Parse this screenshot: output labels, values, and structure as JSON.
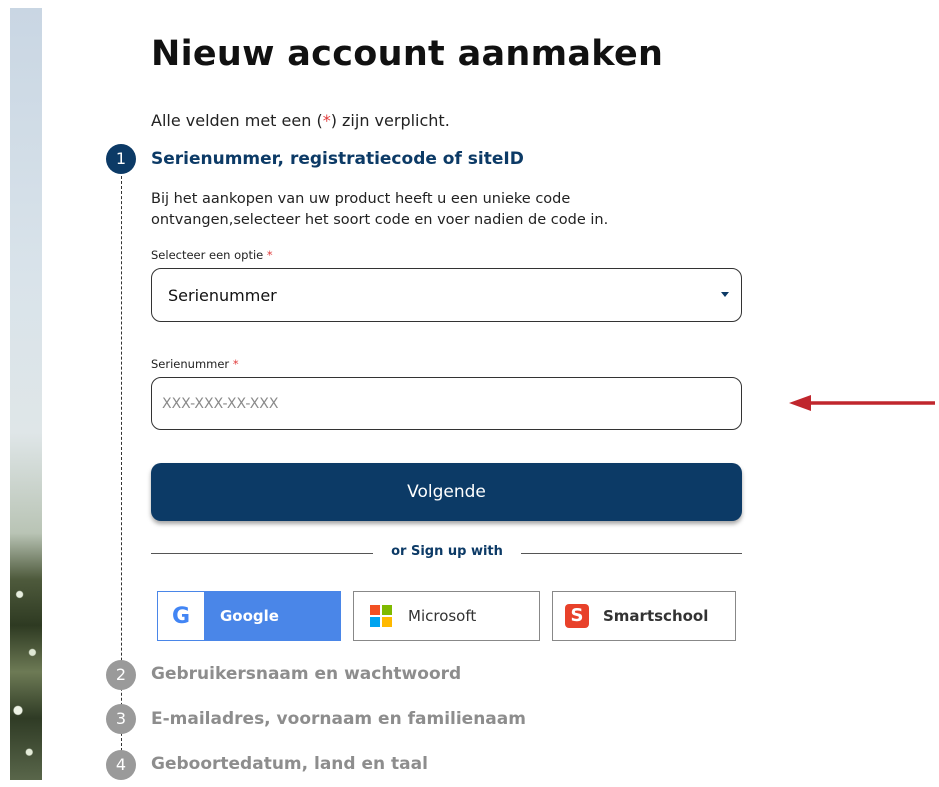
{
  "page": {
    "title": "Nieuw account aanmaken",
    "required_note_prefix": "Alle velden met een (",
    "required_note_star": "*",
    "required_note_suffix": ") zijn verplicht."
  },
  "steps": [
    {
      "number": "1",
      "label": "Serienummer, registratiecode of siteID",
      "state": "active"
    },
    {
      "number": "2",
      "label": "Gebruikersnaam en wachtwoord",
      "state": "inactive"
    },
    {
      "number": "3",
      "label": "E-mailadres, voornaam en familienaam",
      "state": "inactive"
    },
    {
      "number": "4",
      "label": "Geboortedatum, land en taal",
      "state": "inactive"
    }
  ],
  "step1": {
    "description": "Bij het aankopen van uw product heeft u een unieke code ontvangen,selecteer het soort code en voer nadien de code in.",
    "select_label": "Selecteer een optie",
    "select_value": "Serienummer",
    "input_label": "Serienummer",
    "input_placeholder": "XXX-XXX-XX-XXX",
    "input_value": "",
    "required_star": "*",
    "next_button": "Volgende"
  },
  "social": {
    "divider": "or Sign up with",
    "google": "Google",
    "google_letter": "G",
    "microsoft": "Microsoft",
    "smartschool": "Smartschool",
    "smartschool_letter": "S"
  },
  "colors": {
    "primary": "#0c3a66",
    "required": "#e03b3b",
    "google_blue": "#4a86e8",
    "arrow_red": "#c0262d",
    "inactive_step": "#9a9a9a"
  }
}
